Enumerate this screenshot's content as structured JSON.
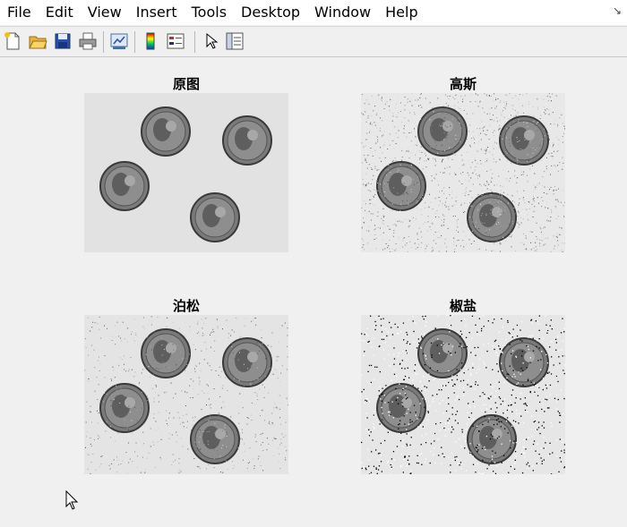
{
  "menu": {
    "items": [
      "File",
      "Edit",
      "View",
      "Insert",
      "Tools",
      "Desktop",
      "Window",
      "Help"
    ]
  },
  "toolbar": {
    "icons": [
      "new-figure-icon",
      "open-file-icon",
      "save-icon",
      "print-icon",
      "link-plot-icon",
      "colorbar-icon",
      "legend-icon",
      "pointer-icon",
      "property-editor-icon"
    ]
  },
  "subplots": [
    {
      "title": "原图",
      "noise": "none"
    },
    {
      "title": "高斯",
      "noise": "gaussian"
    },
    {
      "title": "泊松",
      "noise": "poisson"
    },
    {
      "title": "椒盐",
      "noise": "salt-pepper"
    }
  ],
  "colors": {
    "menubar": "#ffffff",
    "background": "#f0f0f0"
  }
}
